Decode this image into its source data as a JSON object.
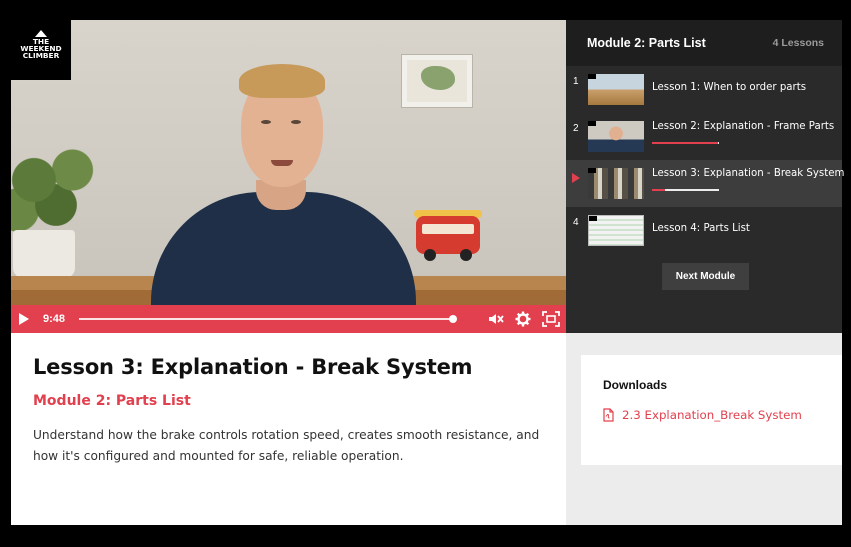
{
  "brand": {
    "logo_line1": "THE WEEKEND",
    "logo_line2": "CLIMBER"
  },
  "player": {
    "time": "9:48",
    "progress": 0.97,
    "mute_icon": "mute-icon",
    "settings_icon": "gear-icon",
    "fullscreen_icon": "fullscreen-icon",
    "accent_color": "#e2404e"
  },
  "panel": {
    "title": "Module 2: Parts List",
    "count": "4 Lessons",
    "lessons": [
      {
        "num": "1",
        "label": "Lesson 1: When to order parts",
        "progress": null
      },
      {
        "num": "2",
        "label": "Lesson 2: Explanation - Frame Parts",
        "progress": 0.99
      },
      {
        "num": "",
        "label": "Lesson 3: Explanation - Break System",
        "progress": 0.2
      },
      {
        "num": "4",
        "label": "Lesson 4: Parts List",
        "progress": null
      }
    ],
    "next_label": "Next Module"
  },
  "info": {
    "title": "Lesson 3: Explanation - Break System",
    "module": "Module 2: Parts List",
    "description": "Understand how the brake controls rotation speed, creates smooth resistance, and how it's configured and mounted for safe, reliable operation."
  },
  "downloads": {
    "heading": "Downloads",
    "file": "2.3 Explanation_Break System"
  }
}
